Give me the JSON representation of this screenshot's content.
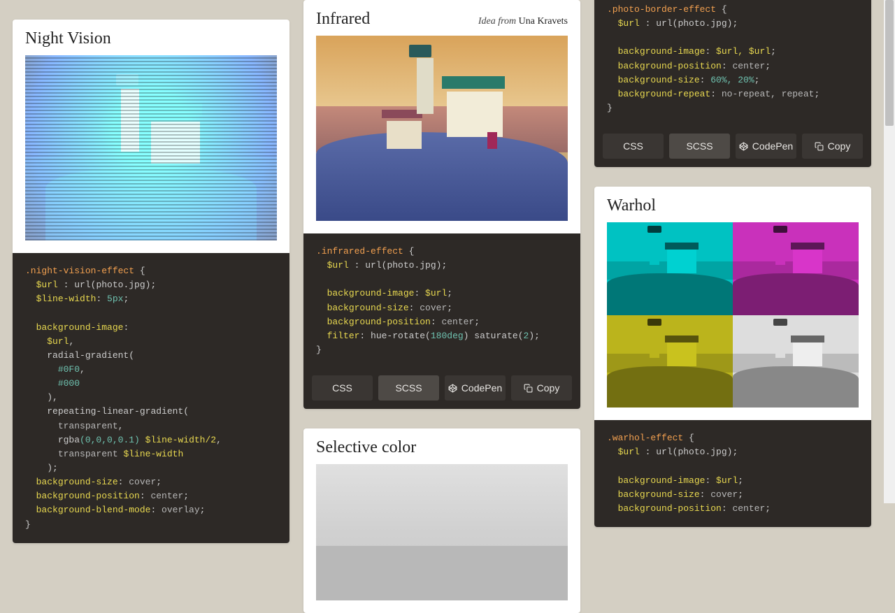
{
  "cards": {
    "night": {
      "title": "Night Vision",
      "code": {
        "selector": ".night-vision-effect",
        "urlvar": "$url",
        "urlval": "url(photo.jpg)",
        "linevar": "$line-width",
        "lineval": "5px",
        "p_bgimg": "background-image",
        "v_url": "$url",
        "fn_radial": "radial-gradient",
        "c1": "#0F0",
        "c2": "#000",
        "fn_repeat": "repeating-linear-gradient",
        "r1": "transparent",
        "r2a": "rgba",
        "r2b": "(0,0,0,0.1)",
        "r2c": "$line-width/2",
        "r3a": "transparent",
        "r3b": "$line-width",
        "p_bgsize": "background-size",
        "v_bgsize": "cover",
        "p_bgpos": "background-position",
        "v_bgpos": "center",
        "p_blend": "background-blend-mode",
        "v_blend": "overlay"
      }
    },
    "infrared": {
      "title": "Infrared",
      "idea_prefix": "Idea from",
      "idea_author": "Una Kravets",
      "code": {
        "selector": ".infrared-effect",
        "urlvar": "$url",
        "urlval": "url(photo.jpg)",
        "p_bgimg": "background-image",
        "v_bgimg": "$url",
        "p_bgsize": "background-size",
        "v_bgsize": "cover",
        "p_bgpos": "background-position",
        "v_bgpos": "center",
        "p_filter": "filter",
        "fn_hue": "hue-rotate",
        "deg": "180deg",
        "fn_sat": "saturate",
        "satv": "2"
      }
    },
    "border": {
      "code": {
        "selector": ".photo-border-effect",
        "urlvar": "$url",
        "urlval": "url(photo.jpg)",
        "p_bgimg": "background-image",
        "v_bgimg": "$url, $url",
        "p_bgpos": "background-position",
        "v_bgpos": "center",
        "p_bgsize": "background-size",
        "v_bgsize": "60%, 20%",
        "p_bgrep": "background-repeat",
        "v_bgrep": "no-repeat, repeat"
      }
    },
    "warhol": {
      "title": "Warhol",
      "code": {
        "selector": ".warhol-effect",
        "urlvar": "$url",
        "urlval": "url(photo.jpg)",
        "p_bgimg": "background-image",
        "v_bgimg": "$url",
        "p_bgsize": "background-size",
        "v_bgsize": "cover",
        "p_bgpos": "background-position",
        "v_bgpos": "center"
      }
    },
    "selective": {
      "title": "Selective color"
    }
  },
  "buttons": {
    "css": "CSS",
    "scss": "SCSS",
    "codepen": "CodePen",
    "copy": "Copy"
  }
}
